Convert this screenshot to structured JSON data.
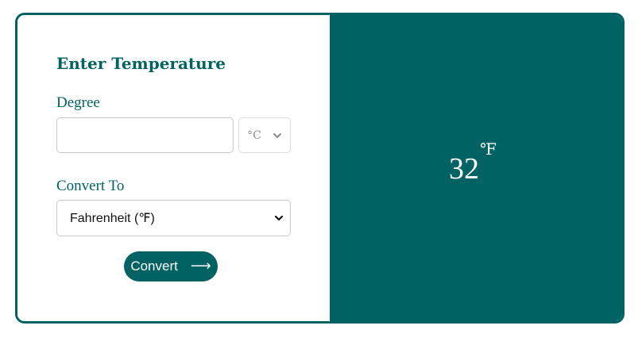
{
  "form": {
    "title": "Enter Temperature",
    "degree_label": "Degree",
    "degree_value": "",
    "unit_selected": "°C",
    "convert_to_label": "Convert To",
    "convert_to_selected": "Fahrenheit (℉)",
    "convert_button_label": "Convert",
    "convert_button_arrow": "⟶"
  },
  "result": {
    "value": "32",
    "unit": "℉"
  },
  "colors": {
    "accent": "#006262",
    "background": "#ffffff",
    "input_border": "#c8c8c8"
  },
  "icons": {
    "unit_dropdown": "chevron-down-icon",
    "convert_dropdown": "chevron-down-icon",
    "convert_button": "arrow-right-icon"
  }
}
